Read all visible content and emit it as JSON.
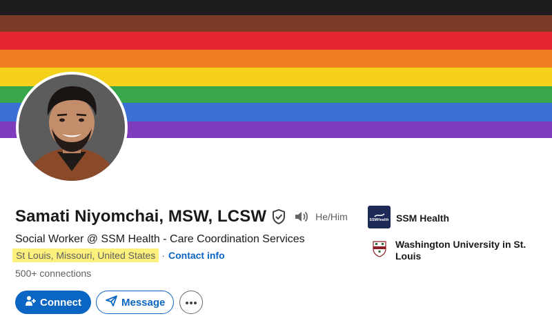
{
  "profile": {
    "name": "Samati Niyomchai, MSW, LCSW",
    "pronouns": "He/Him",
    "headline": "Social Worker @ SSM Health - Care Coordination Services",
    "location": "St Louis, Missouri, United States",
    "separator": "·",
    "contact_info": "Contact info",
    "connections": "500+ connections"
  },
  "actions": {
    "connect": "Connect",
    "message": "Message"
  },
  "sidebar": {
    "items": [
      {
        "label": "SSM Health",
        "logo": "ssm-health-logo",
        "logo_text": "SSMHealth"
      },
      {
        "label": "Washington University in St. Louis",
        "logo": "washu-shield-logo"
      }
    ]
  },
  "banner": {
    "stripes": [
      "#1e1c1e",
      "#7a3b26",
      "#e5252f",
      "#ef7f22",
      "#f5d11c",
      "#3aa64a",
      "#3b6fd3",
      "#7f3dbd"
    ]
  },
  "colors": {
    "accent": "#0a66c2",
    "location_highlight": "#fdf17e"
  }
}
